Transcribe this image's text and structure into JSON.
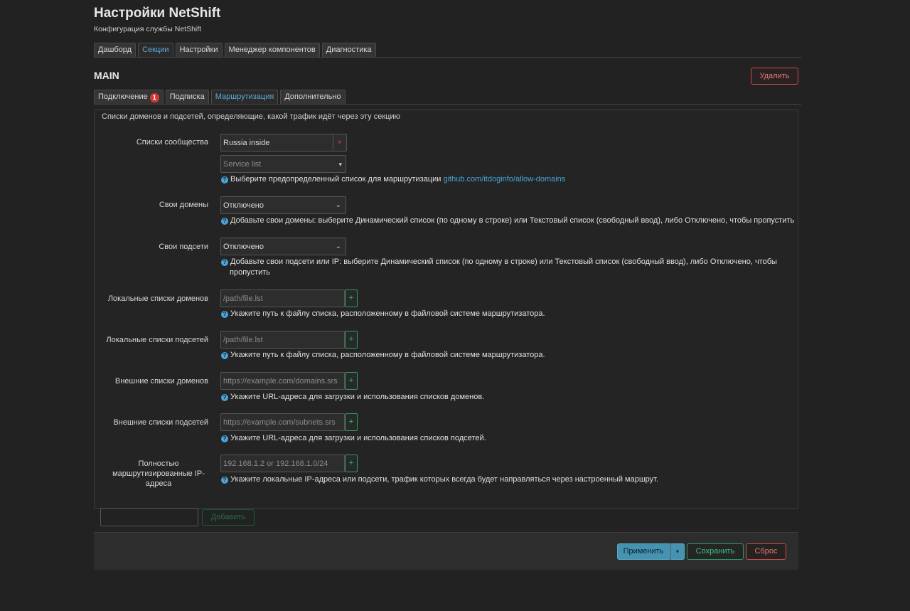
{
  "page": {
    "title": "Настройки NetShift",
    "subtitle": "Конфигурация службы NetShift"
  },
  "main_tabs": [
    {
      "label": "Дашборд",
      "active": false
    },
    {
      "label": "Секции",
      "active": true
    },
    {
      "label": "Настройки",
      "active": false
    },
    {
      "label": "Менеджер компонентов",
      "active": false
    },
    {
      "label": "Диагностика",
      "active": false
    }
  ],
  "section": {
    "title": "MAIN",
    "delete_label": "Удалить"
  },
  "sub_tabs": [
    {
      "label": "Подключение",
      "badge": "1",
      "active": false
    },
    {
      "label": "Подписка",
      "active": false
    },
    {
      "label": "Маршрутизация",
      "active": true
    },
    {
      "label": "Дополнительно",
      "active": false
    }
  ],
  "panel": {
    "description": "Списки доменов и подсетей, определяющие, какой трафик идёт через эту секцию"
  },
  "community_lists": {
    "label": "Списки сообщества",
    "selected_value": "Russia inside",
    "remove_glyph": "×",
    "dropdown_placeholder": "Service list",
    "help_text": "Выберите предопределенный список для маршрутизации ",
    "help_link": "github.com/itdoginfo/allow-domains"
  },
  "own_domains": {
    "label": "Свои домены",
    "value": "Отключено",
    "help": "Добавьте свои домены: выберите Динамический список (по одному в строке) или Текстовый список (свободный ввод), либо Отключено, чтобы пропустить"
  },
  "own_subnets": {
    "label": "Свои подсети",
    "value": "Отключено",
    "help_line1": "Добавьте свои подсети или IP: выберите Динамический список (по одному в строке) или Текстовый список (свободный ввод), либо Отключено, чтобы",
    "help_line2": "пропустить"
  },
  "local_domain_lists": {
    "label": "Локальные списки доменов",
    "placeholder": "/path/file.lst",
    "help": "Укажите путь к файлу списка, расположенному в файловой системе маршрутизатора."
  },
  "local_subnet_lists": {
    "label": "Локальные списки подсетей",
    "placeholder": "/path/file.lst",
    "help": "Укажите путь к файлу списка, расположенному в файловой системе маршрутизатора."
  },
  "external_domain_lists": {
    "label": "Внешние списки доменов",
    "placeholder": "https://example.com/domains.srs",
    "help": "Укажите URL-адреса для загрузки и использования списков доменов."
  },
  "external_subnet_lists": {
    "label": "Внешние списки подсетей",
    "placeholder": "https://example.com/subnets.srs",
    "help": "Укажите URL-адреса для загрузки и использования списков подсетей."
  },
  "full_routed_ips": {
    "label_line1": "Полностью",
    "label_line2": "маршрутизированные IP-",
    "label_line3": "адреса",
    "placeholder": "192.168.1.2 or 192.168.1.0/24",
    "help": "Укажите локальные IP-адреса или подсети, трафик которых всегда будет направляться через настроенный маршрут."
  },
  "add_section": {
    "button_label": "Добавить"
  },
  "footer": {
    "apply_label": "Применить",
    "apply_dropdown_glyph": "▾",
    "save_label": "Сохранить",
    "reset_label": "Сброс"
  },
  "icons": {
    "help": "question-circle-icon",
    "plus": "+",
    "chevron": "⌄",
    "dropdown_arrow": "▾"
  },
  "colors": {
    "accent": "#4aa3d9",
    "danger": "#c9504b",
    "success": "#2f9a6a",
    "apply": "#4593b0",
    "badge": "#d23b33"
  }
}
